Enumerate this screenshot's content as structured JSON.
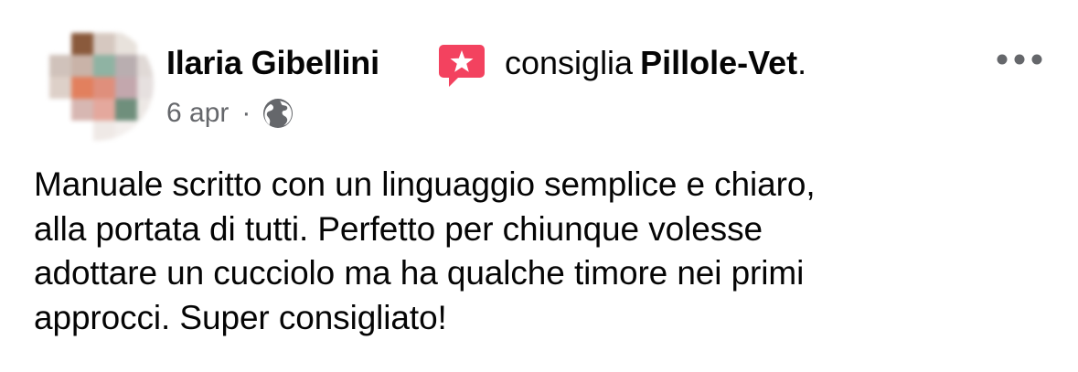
{
  "post": {
    "author": "Ilaria Gibellini",
    "action": "consiglia",
    "page_name": "Pillole-Vet",
    "page_suffix": ".",
    "date": "6 apr",
    "separator": "·",
    "audience_icon": "globe-icon",
    "recommend_icon": "recommend-star-icon",
    "more_icon": "more-options-icon",
    "text": "Manuale scritto con un linguaggio semplice e chiaro,\nalla portata di tutti. Perfetto per chiunque volesse\nadottare un cucciolo ma ha qualche timore nei primi\napprocci. Super consigliato!"
  },
  "colors": {
    "recommend_badge": "#f3425f",
    "meta_text": "#65676b",
    "body_text": "#050505",
    "more_dots": "#65676b"
  },
  "avatar": {
    "pixel_colors": [
      "#ffffff",
      "#8a5a3c",
      "#d6c8c0",
      "#e8e2dc",
      "#ffffff",
      "#d0c2bb",
      "#c9b3a8",
      "#8fb3a3",
      "#b9aeb0",
      "#e0d9d6",
      "#ddd0c8",
      "#e2805e",
      "#df8f7c",
      "#c3a7ad",
      "#e6e0df",
      "#ffffff",
      "#d7b7b2",
      "#e4a89d",
      "#6f8f7c",
      "#ede8e5",
      "#ffffff",
      "#ffffff",
      "#efe9e6",
      "#f3efed",
      "#ffffff"
    ]
  }
}
